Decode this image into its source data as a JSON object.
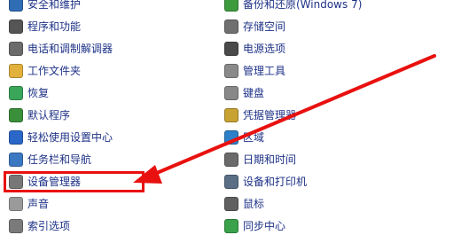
{
  "left_items": [
    {
      "label": "安全和维护",
      "icon": "security-maintenance-icon",
      "color": "#2f6db5"
    },
    {
      "label": "程序和功能",
      "icon": "programs-features-icon",
      "color": "#555555"
    },
    {
      "label": "电话和调制解调器",
      "icon": "phone-modem-icon",
      "color": "#6b6b6b"
    },
    {
      "label": "工作文件夹",
      "icon": "work-folders-icon",
      "color": "#e2b13c"
    },
    {
      "label": "恢复",
      "icon": "recovery-icon",
      "color": "#3aa65a"
    },
    {
      "label": "默认程序",
      "icon": "default-programs-icon",
      "color": "#3a8f3a"
    },
    {
      "label": "轻松使用设置中心",
      "icon": "ease-of-access-icon",
      "color": "#2a67c9"
    },
    {
      "label": "任务栏和导航",
      "icon": "taskbar-navigation-icon",
      "color": "#3b78c2"
    },
    {
      "label": "设备管理器",
      "icon": "device-manager-icon",
      "color": "#777777"
    },
    {
      "label": "声音",
      "icon": "sound-icon",
      "color": "#9a9a9a"
    },
    {
      "label": "索引选项",
      "icon": "indexing-options-icon",
      "color": "#7a7a7a"
    }
  ],
  "right_items": [
    {
      "label": "备份和还原(Windows 7)",
      "icon": "backup-restore-icon",
      "color": "#3d9a3d"
    },
    {
      "label": "存储空间",
      "icon": "storage-spaces-icon",
      "color": "#707070"
    },
    {
      "label": "电源选项",
      "icon": "power-options-icon",
      "color": "#4a4a4a"
    },
    {
      "label": "管理工具",
      "icon": "administrative-tools-icon",
      "color": "#8a8a8a"
    },
    {
      "label": "键盘",
      "icon": "keyboard-icon",
      "color": "#888888"
    },
    {
      "label": "凭据管理器",
      "icon": "credential-manager-icon",
      "color": "#c8a233"
    },
    {
      "label": "区域",
      "icon": "region-icon",
      "color": "#2d7fc7"
    },
    {
      "label": "日期和时间",
      "icon": "date-time-icon",
      "color": "#6a6a6a"
    },
    {
      "label": "设备和打印机",
      "icon": "devices-printers-icon",
      "color": "#5a6f86"
    },
    {
      "label": "鼠标",
      "icon": "mouse-icon",
      "color": "#606060"
    },
    {
      "label": "同步中心",
      "icon": "sync-center-icon",
      "color": "#39a24a"
    }
  ],
  "annotation_color": "#e8110f"
}
